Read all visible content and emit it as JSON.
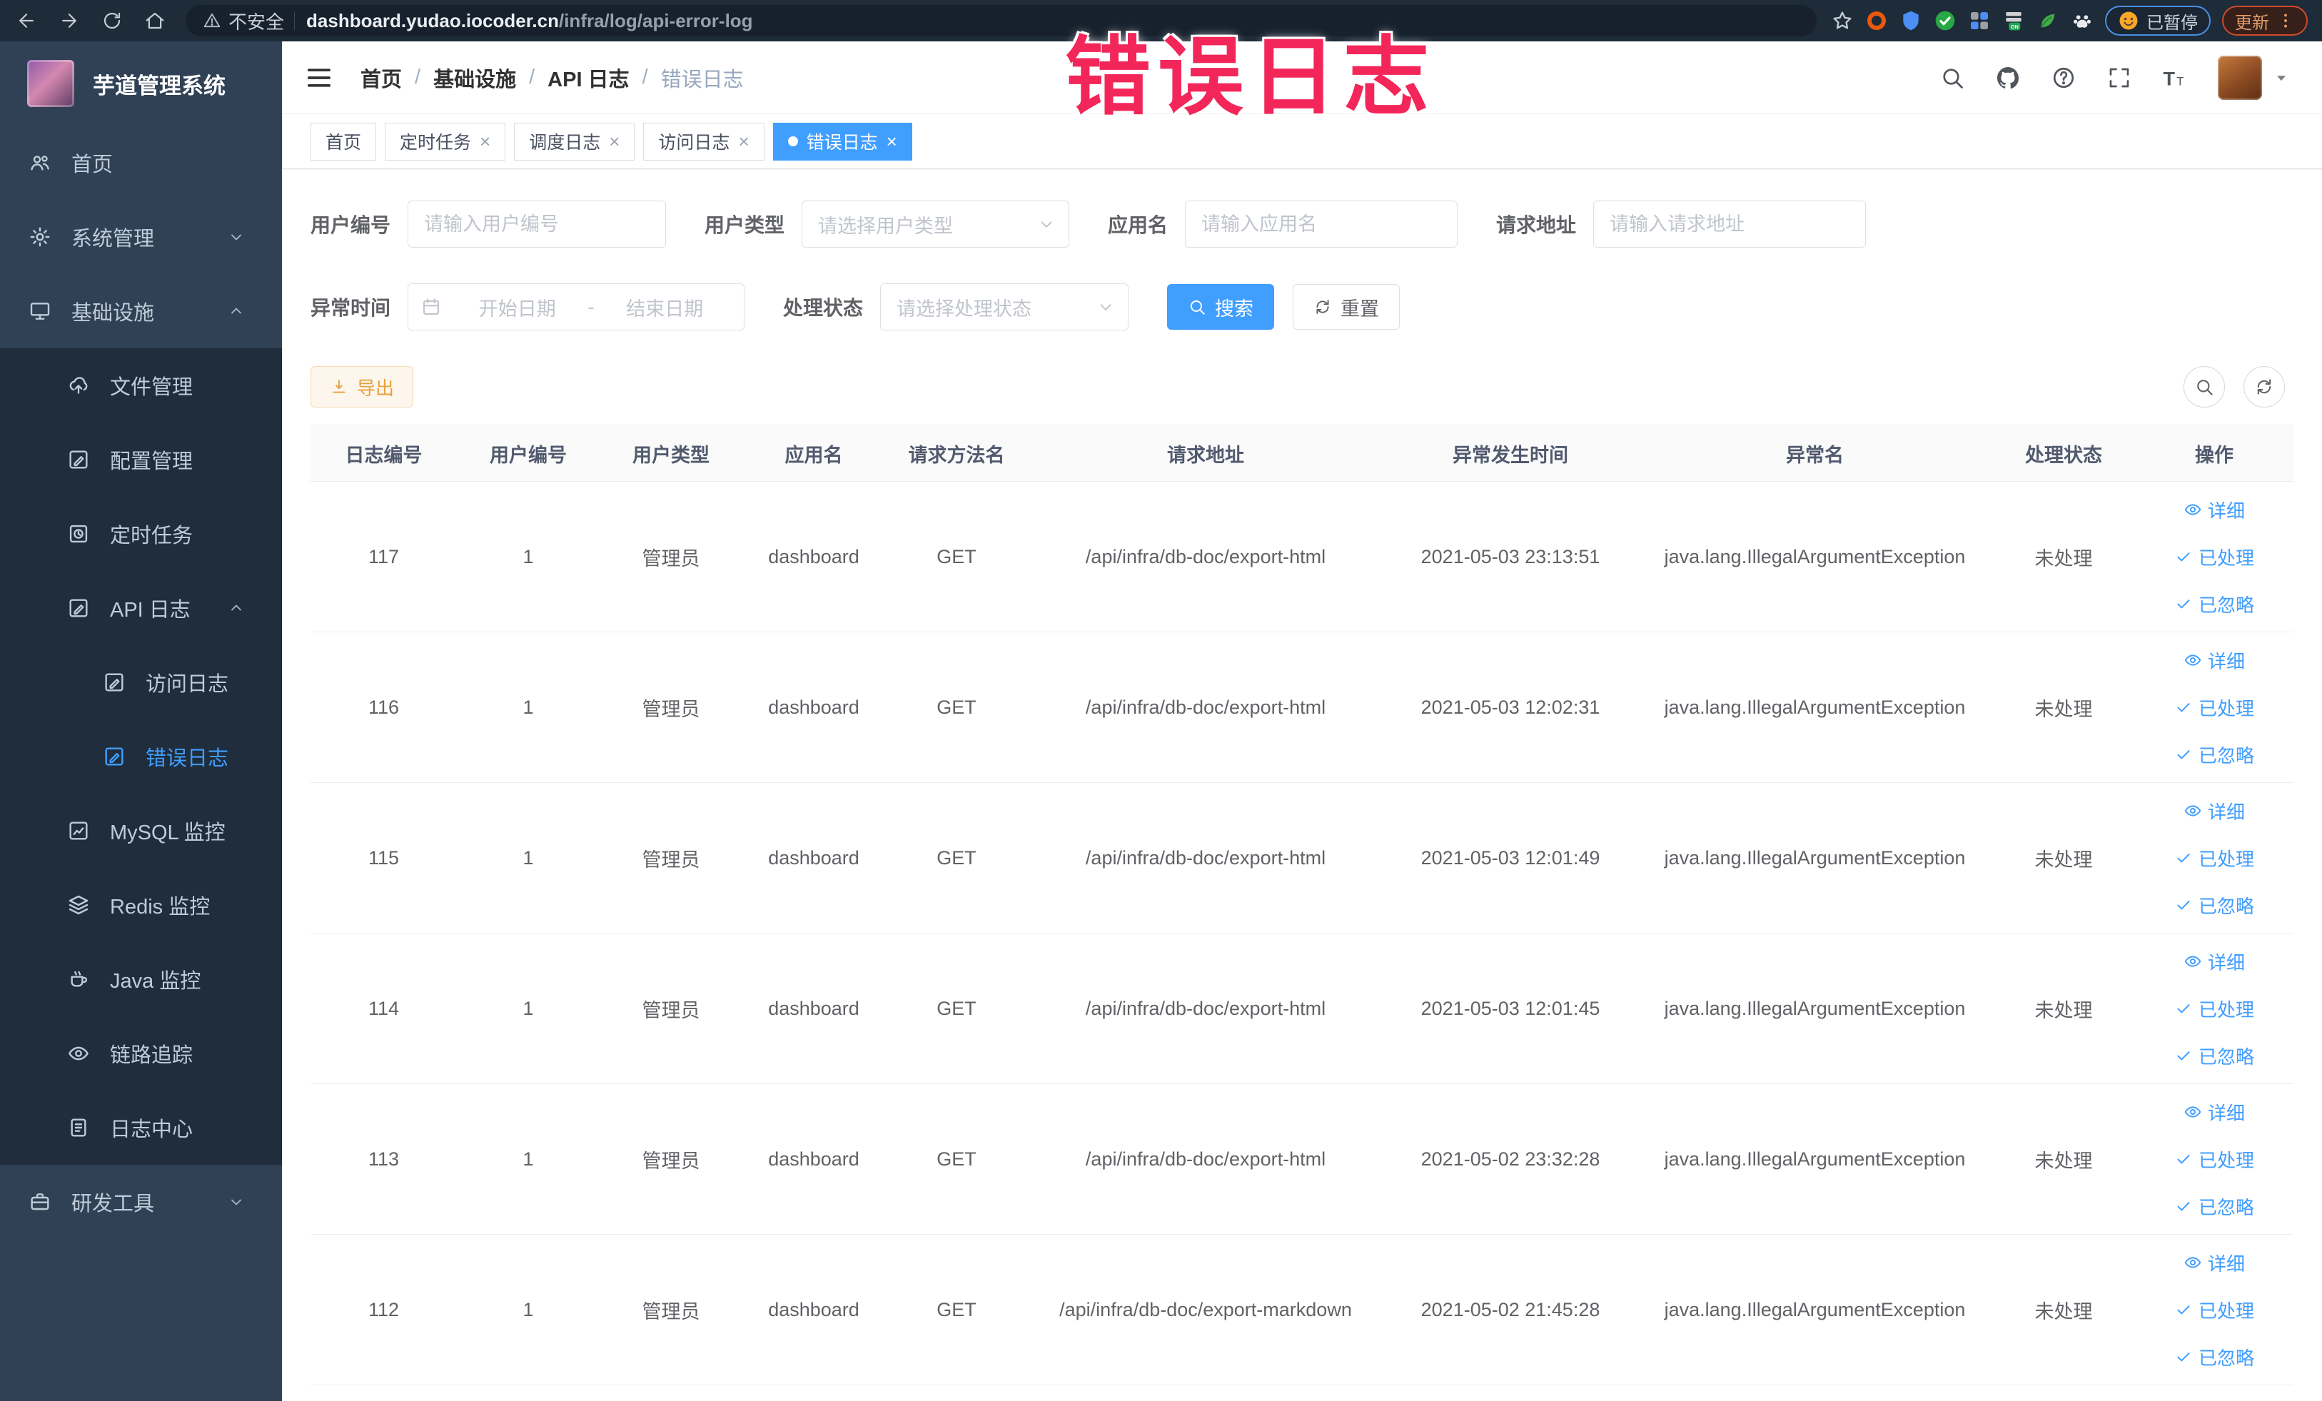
{
  "colors": {
    "accent": "#409eff",
    "warning": "#e6a23c",
    "annotation_red": "#f3265a",
    "sidebar_bg": "#304156",
    "sidebar_sub_bg": "#1f2d3d"
  },
  "browser": {
    "nav_icons": [
      "back-icon",
      "forward-icon",
      "reload-icon",
      "home-icon"
    ],
    "security_label": "不安全",
    "url_host": "dashboard.yudao.iocoder.cn",
    "url_path": "/infra/log/api-error-log",
    "extension_icons": [
      "bookmark-star-icon",
      "orange-ring-icon",
      "blue-shield-icon",
      "green-check-icon",
      "grid-icon",
      "on-badge-icon",
      "leaf-icon",
      "paw-icon"
    ],
    "paused_label": "已暂停",
    "update_label": "更新"
  },
  "annotation": {
    "text": "错误日志"
  },
  "sidebar": {
    "title": "芋道管理系统",
    "items": [
      {
        "key": "home",
        "label": "首页",
        "icon": "peoples-icon",
        "level": 1,
        "dark": false,
        "active": false,
        "chevron": null
      },
      {
        "key": "system",
        "label": "系统管理",
        "icon": "gear-icon",
        "level": 1,
        "dark": false,
        "active": false,
        "chevron": "down"
      },
      {
        "key": "infra",
        "label": "基础设施",
        "icon": "monitor-icon",
        "level": 1,
        "dark": false,
        "active": false,
        "chevron": "up"
      },
      {
        "key": "file",
        "label": "文件管理",
        "icon": "cloud-upload-icon",
        "level": 2,
        "dark": true,
        "active": false,
        "chevron": null
      },
      {
        "key": "config",
        "label": "配置管理",
        "icon": "edit-square-icon",
        "level": 2,
        "dark": true,
        "active": false,
        "chevron": null
      },
      {
        "key": "job",
        "label": "定时任务",
        "icon": "timer-icon",
        "level": 2,
        "dark": true,
        "active": false,
        "chevron": null
      },
      {
        "key": "api-log",
        "label": "API 日志",
        "icon": "edit-square-icon",
        "level": 2,
        "dark": true,
        "active": false,
        "chevron": "up"
      },
      {
        "key": "access-log",
        "label": "访问日志",
        "icon": "edit-square-icon",
        "level": 3,
        "dark": true,
        "active": false,
        "chevron": null
      },
      {
        "key": "error-log",
        "label": "错误日志",
        "icon": "edit-square-icon",
        "level": 3,
        "dark": true,
        "active": true,
        "chevron": null
      },
      {
        "key": "mysql",
        "label": "MySQL 监控",
        "icon": "chart-icon",
        "level": 2,
        "dark": true,
        "active": false,
        "chevron": null
      },
      {
        "key": "redis",
        "label": "Redis 监控",
        "icon": "layers-icon",
        "level": 2,
        "dark": true,
        "active": false,
        "chevron": null
      },
      {
        "key": "java",
        "label": "Java 监控",
        "icon": "coffee-icon",
        "level": 2,
        "dark": true,
        "active": false,
        "chevron": null
      },
      {
        "key": "trace",
        "label": "链路追踪",
        "icon": "eye-icon",
        "level": 2,
        "dark": true,
        "active": false,
        "chevron": null
      },
      {
        "key": "log-center",
        "label": "日志中心",
        "icon": "doc-icon",
        "level": 2,
        "dark": true,
        "active": false,
        "chevron": null
      },
      {
        "key": "dev-tool",
        "label": "研发工具",
        "icon": "briefcase-icon",
        "level": 1,
        "dark": false,
        "active": false,
        "chevron": "down"
      }
    ]
  },
  "topbar": {
    "breadcrumbs": [
      "首页",
      "基础设施",
      "API 日志",
      "错误日志"
    ],
    "separator": "/",
    "tool_icons": [
      "search-icon",
      "github-icon",
      "help-icon",
      "fullscreen-icon",
      "font-size-icon"
    ]
  },
  "tabs": [
    {
      "label": "首页",
      "closable": false,
      "active": false
    },
    {
      "label": "定时任务",
      "closable": true,
      "active": false
    },
    {
      "label": "调度日志",
      "closable": true,
      "active": false
    },
    {
      "label": "访问日志",
      "closable": true,
      "active": false
    },
    {
      "label": "错误日志",
      "closable": true,
      "active": true
    }
  ],
  "filters": {
    "user_id": {
      "label": "用户编号",
      "placeholder": "请输入用户编号"
    },
    "user_type": {
      "label": "用户类型",
      "placeholder": "请选择用户类型"
    },
    "app_name": {
      "label": "应用名",
      "placeholder": "请输入应用名"
    },
    "request_url": {
      "label": "请求地址",
      "placeholder": "请输入请求地址"
    },
    "exception_time": {
      "label": "异常时间",
      "start_placeholder": "开始日期",
      "separator": "-",
      "end_placeholder": "结束日期"
    },
    "process_status": {
      "label": "处理状态",
      "placeholder": "请选择处理状态"
    },
    "search_label": "搜索",
    "reset_label": "重置"
  },
  "toolbar": {
    "export_label": "导出"
  },
  "table": {
    "columns": [
      "日志编号",
      "用户编号",
      "用户类型",
      "应用名",
      "请求方法名",
      "请求地址",
      "异常发生时间",
      "异常名",
      "处理状态",
      "操作"
    ],
    "row_actions": [
      {
        "label": "详细",
        "icon": "view-icon"
      },
      {
        "label": "已处理",
        "icon": "check-icon"
      },
      {
        "label": "已忽略",
        "icon": "check-icon"
      }
    ],
    "rows": [
      {
        "id": "117",
        "user_id": "1",
        "user_type": "管理员",
        "app": "dashboard",
        "method": "GET",
        "url": "/api/infra/db-doc/export-html",
        "time": "2021-05-03 23:13:51",
        "exception": "java.lang.IllegalArgumentException",
        "status": "未处理"
      },
      {
        "id": "116",
        "user_id": "1",
        "user_type": "管理员",
        "app": "dashboard",
        "method": "GET",
        "url": "/api/infra/db-doc/export-html",
        "time": "2021-05-03 12:02:31",
        "exception": "java.lang.IllegalArgumentException",
        "status": "未处理"
      },
      {
        "id": "115",
        "user_id": "1",
        "user_type": "管理员",
        "app": "dashboard",
        "method": "GET",
        "url": "/api/infra/db-doc/export-html",
        "time": "2021-05-03 12:01:49",
        "exception": "java.lang.IllegalArgumentException",
        "status": "未处理"
      },
      {
        "id": "114",
        "user_id": "1",
        "user_type": "管理员",
        "app": "dashboard",
        "method": "GET",
        "url": "/api/infra/db-doc/export-html",
        "time": "2021-05-03 12:01:45",
        "exception": "java.lang.IllegalArgumentException",
        "status": "未处理"
      },
      {
        "id": "113",
        "user_id": "1",
        "user_type": "管理员",
        "app": "dashboard",
        "method": "GET",
        "url": "/api/infra/db-doc/export-html",
        "time": "2021-05-02 23:32:28",
        "exception": "java.lang.IllegalArgumentException",
        "status": "未处理"
      },
      {
        "id": "112",
        "user_id": "1",
        "user_type": "管理员",
        "app": "dashboard",
        "method": "GET",
        "url": "/api/infra/db-doc/export-markdown",
        "time": "2021-05-02 21:45:28",
        "exception": "java.lang.IllegalArgumentException",
        "status": "未处理"
      }
    ]
  }
}
